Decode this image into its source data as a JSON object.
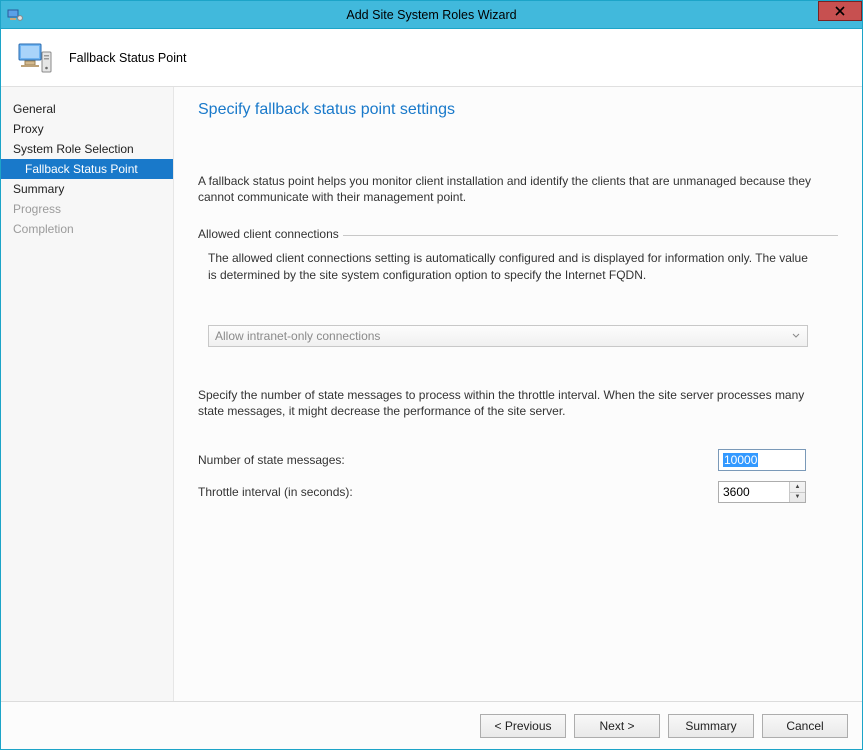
{
  "window": {
    "title": "Add Site System Roles Wizard"
  },
  "header": {
    "label": "Fallback Status Point"
  },
  "sidebar": {
    "items": [
      {
        "label": "General",
        "state": "normal"
      },
      {
        "label": "Proxy",
        "state": "normal"
      },
      {
        "label": "System Role Selection",
        "state": "normal"
      },
      {
        "label": "Fallback Status Point",
        "state": "selected"
      },
      {
        "label": "Summary",
        "state": "normal"
      },
      {
        "label": "Progress",
        "state": "disabled"
      },
      {
        "label": "Completion",
        "state": "disabled"
      }
    ]
  },
  "content": {
    "heading": "Specify fallback status point settings",
    "description": "A fallback status point helps you monitor client installation and identify the clients that are unmanaged because they cannot communicate with their management point.",
    "group": {
      "label": "Allowed client connections",
      "description": "The allowed client connections setting is automatically configured and is displayed for information only. The value is determined by the site system configuration option to specify the Internet FQDN.",
      "combo_value": "Allow intranet-only connections"
    },
    "throttle_desc": "Specify the number of state messages to process within the throttle interval. When the site server processes many state messages, it might decrease the performance of the site server.",
    "fields": {
      "num_messages_label": "Number of state messages:",
      "num_messages_value": "10000",
      "throttle_label": "Throttle interval (in seconds):",
      "throttle_value": "3600"
    }
  },
  "footer": {
    "previous": "< Previous",
    "next": "Next >",
    "summary": "Summary",
    "cancel": "Cancel"
  }
}
